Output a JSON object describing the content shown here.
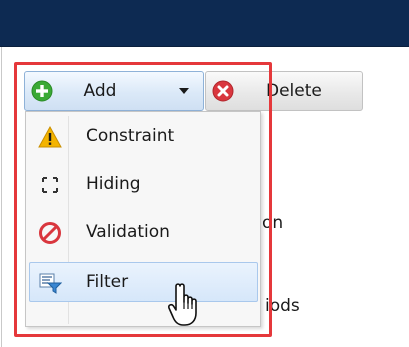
{
  "toolbar": {
    "add_label": "Add",
    "delete_label": "Delete"
  },
  "menu": {
    "items": [
      {
        "label": "Constraint",
        "icon": "warning-icon"
      },
      {
        "label": "Hiding",
        "icon": "hiding-brackets-icon"
      },
      {
        "label": "Validation",
        "icon": "no-entry-icon"
      },
      {
        "label": "Filter",
        "icon": "filter-icon"
      }
    ]
  },
  "background": {
    "partial_text_1": "on",
    "partial_text_2": "iods"
  },
  "colors": {
    "header": "#0d2a52",
    "highlight": "#e5383b",
    "add_icon": "#3aa935",
    "delete_icon": "#d9363e",
    "warning_icon": "#f4b400"
  }
}
